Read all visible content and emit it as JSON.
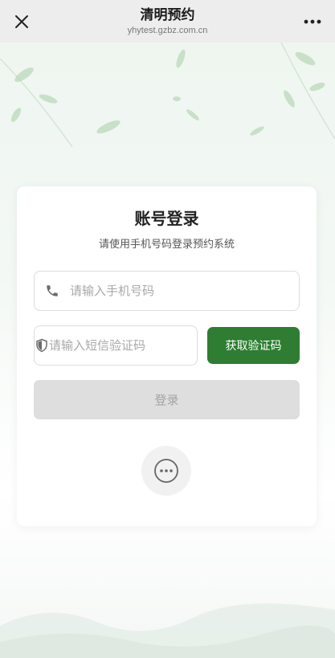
{
  "header": {
    "title": "清明预约",
    "subtitle": "yhytest.gzbz.com.cn",
    "close_icon": "close-icon",
    "more_icon": "more-icon"
  },
  "login": {
    "title": "账号登录",
    "subtitle": "请使用手机号码登录预约系统",
    "phone_placeholder": "请输入手机号码",
    "code_placeholder": "请输入短信验证码",
    "get_code_label": "获取验证码",
    "login_label": "登录",
    "phone_icon": "phone-icon",
    "shield_icon": "shield-icon",
    "other_login_icon": "more-options-icon"
  },
  "colors": {
    "accent": "#2e7d32",
    "login_disabled_bg": "#dedede",
    "login_disabled_text": "#a3a3a3",
    "topbar_bg": "#ededed"
  }
}
